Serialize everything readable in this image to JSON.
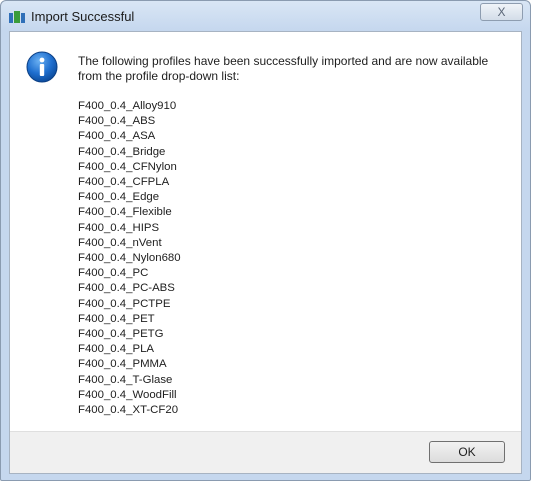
{
  "window": {
    "title": "Import Successful",
    "close_label": "X"
  },
  "message": "The following profiles have been successfully imported and are now available from the profile drop-down list:",
  "profiles": [
    "F400_0.4_Alloy910",
    "F400_0.4_ABS",
    "F400_0.4_ASA",
    "F400_0.4_Bridge",
    "F400_0.4_CFNylon",
    "F400_0.4_CFPLA",
    "F400_0.4_Edge",
    "F400_0.4_Flexible",
    "F400_0.4_HIPS",
    "F400_0.4_nVent",
    "F400_0.4_Nylon680",
    "F400_0.4_PC",
    "F400_0.4_PC-ABS",
    "F400_0.4_PCTPE",
    "F400_0.4_PET",
    "F400_0.4_PETG",
    "F400_0.4_PLA",
    "F400_0.4_PMMA",
    "F400_0.4_T-Glase",
    "F400_0.4_WoodFill",
    "F400_0.4_XT-CF20"
  ],
  "buttons": {
    "ok": "OK"
  },
  "icons": {
    "app": "app-icon",
    "info": "info-icon"
  }
}
